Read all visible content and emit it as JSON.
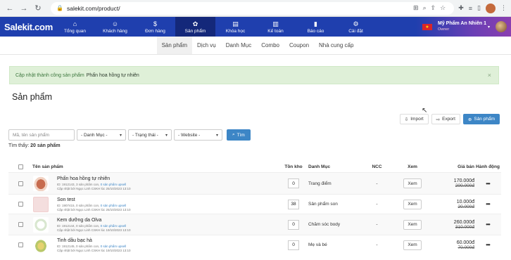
{
  "browser": {
    "url": "salekit.com/product/"
  },
  "header": {
    "logo": "Salekit.com",
    "nav": [
      {
        "label": "Tổng quan",
        "icon": "⌂"
      },
      {
        "label": "Khách hàng",
        "icon": "☺"
      },
      {
        "label": "Đơn hàng",
        "icon": "$"
      },
      {
        "label": "Sản phẩm",
        "icon": "✿"
      },
      {
        "label": "Khóa học",
        "icon": "▤"
      },
      {
        "label": "Kế toán",
        "icon": "▥"
      },
      {
        "label": "Báo cáo",
        "icon": "▮"
      },
      {
        "label": "Cài đặt",
        "icon": "⚙"
      }
    ],
    "account_name": "Mỹ Phẩm An Nhiên 1",
    "account_role": "Owner",
    "colors": {
      "bar": "#1f3fae",
      "active": "#14287a"
    }
  },
  "subnav": [
    "Sản phẩm",
    "Dịch vụ",
    "Danh Mục",
    "Combo",
    "Coupon",
    "Nhà cung cấp"
  ],
  "alert": {
    "text": "Cập nhật thành công sản phẩm",
    "product": "Phấn hoa hồng tự nhiên",
    "close": "×"
  },
  "page_title": "Sản phẩm",
  "actions": {
    "import": "Import",
    "export": "Export",
    "add": "Sản phẩm"
  },
  "filters": {
    "search_placeholder": "Mã, tên sản phẩm",
    "category": "- Danh Mục -",
    "status": "- Trạng thái -",
    "website": "- Website -",
    "search_button": "Tìm"
  },
  "found": {
    "label": "Tìm thấy:",
    "value": "20 sản phẩm"
  },
  "table": {
    "headers": {
      "name": "Tên sản phẩm",
      "stock": "Tồn kho",
      "category": "Danh Mục",
      "ncc": "NCC",
      "view": "Xem",
      "price": "Giá bán",
      "actions": "Hành động"
    },
    "rows": [
      {
        "name": "Phấn hoa hồng tự nhiên",
        "meta_id": "ID: 1912143, 3 sản phẩm con,",
        "meta_link": "0 sản phẩm upsell",
        "meta_updated": "Cập nhật bởi Ngọc Linh CSKH lúc 25/10/2023 13:10",
        "stock": "0",
        "category": "Trang điểm",
        "ncc": "-",
        "view": "Xem",
        "price": "170.000đ",
        "old_price": "200.000đ"
      },
      {
        "name": "Son test",
        "meta_id": "ID: 1907415, 0 sản phẩm con,",
        "meta_link": "0 sản phẩm upsell",
        "meta_updated": "Cập nhật bởi Ngọc Linh CSKH lúc 25/10/2023 13:10",
        "stock": "38",
        "category": "Sản phẩm son",
        "ncc": "-",
        "view": "Xem",
        "price": "10.000đ",
        "old_price": "20.000đ"
      },
      {
        "name": "Kem dưỡng da Olva",
        "meta_id": "ID: 1912144, 0 sản phẩm con,",
        "meta_link": "0 sản phẩm upsell",
        "meta_updated": "Cập nhật bởi Ngọc Linh CSKH lúc 19/10/2023 13:10",
        "stock": "0",
        "category": "Chăm sóc body",
        "ncc": "-",
        "view": "Xem",
        "price": "260.000đ",
        "old_price": "310.000đ"
      },
      {
        "name": "Tinh dầu bạc hà",
        "meta_id": "ID: 1912145, 0 sản phẩm con,",
        "meta_link": "0 sản phẩm upsell",
        "meta_updated": "Cập nhật bởi Ngọc Linh CSKH lúc 19/10/2023 13:10",
        "stock": "0",
        "category": "Mẹ và bé",
        "ncc": "-",
        "view": "Xem",
        "price": "60.000đ",
        "old_price": "70.000đ"
      }
    ]
  }
}
